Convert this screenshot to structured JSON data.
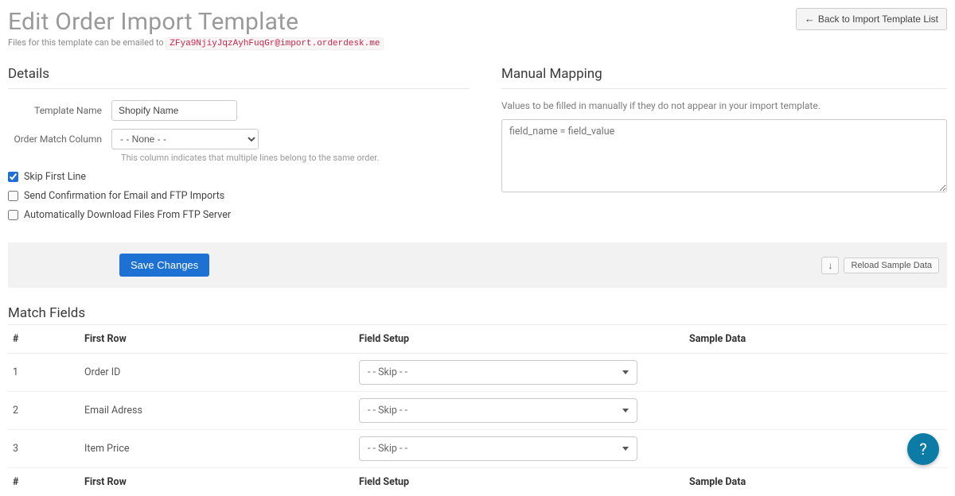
{
  "header": {
    "title": "Edit Order Import Template",
    "back_label": "Back to Import Template List",
    "back_arrow": "←",
    "email_prefix": "Files for this template can be emailed to",
    "email_address": "ZFya9NjiyJqzAyhFuqGr@import.orderdesk.me"
  },
  "details": {
    "title": "Details",
    "template_name_label": "Template Name",
    "template_name_value": "Shopify Name",
    "order_match_label": "Order Match Column",
    "order_match_value": "- - None - -",
    "order_match_hint": "This column indicates that multiple lines belong to the same order.",
    "skip_first_label": "Skip First Line",
    "skip_first_checked": true,
    "send_confirmation_label": "Send Confirmation for Email and FTP Imports",
    "send_confirmation_checked": false,
    "auto_download_label": "Automatically Download Files From FTP Server",
    "auto_download_checked": false
  },
  "mapping": {
    "title": "Manual Mapping",
    "hint": "Values to be filled in manually if they do not appear in your import template.",
    "placeholder": "field_name = field_value"
  },
  "actions": {
    "save_label": "Save Changes",
    "reload_icon": "↓",
    "reload_label": "Reload Sample Data"
  },
  "match": {
    "title": "Match Fields",
    "columns": {
      "num": "#",
      "first_row": "First Row",
      "field_setup": "Field Setup",
      "sample_data": "Sample Data"
    },
    "rows": [
      {
        "num": "1",
        "first_row": "Order ID",
        "field_setup": "- - Skip - -",
        "sample": ""
      },
      {
        "num": "2",
        "first_row": "Email Adress",
        "field_setup": "- - Skip - -",
        "sample": ""
      },
      {
        "num": "3",
        "first_row": "Item Price",
        "field_setup": "- - Skip - -",
        "sample": ""
      }
    ]
  },
  "help": {
    "label": "?"
  }
}
